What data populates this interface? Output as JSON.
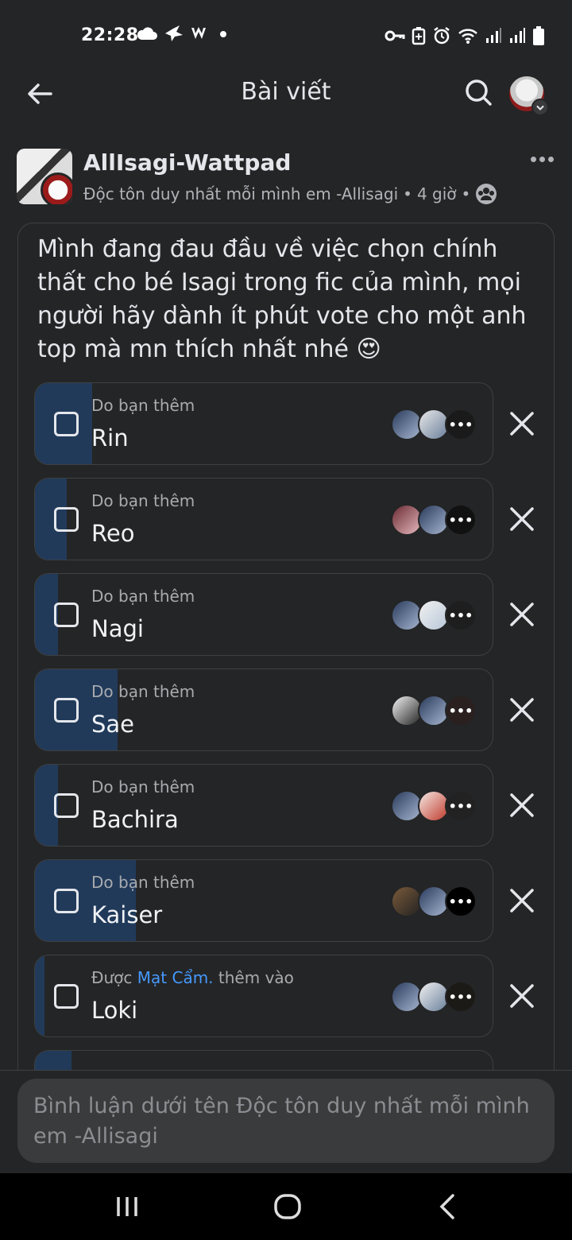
{
  "status_bar": {
    "time": "22:28",
    "left_icons": [
      "cloud-icon",
      "bird-icon",
      "w-icon",
      "dot-icon"
    ],
    "right_icons": [
      "key-icon",
      "battery-saver-icon",
      "alarm-icon",
      "wifi-icon",
      "signal-icon",
      "signal-icon",
      "battery-icon"
    ]
  },
  "header": {
    "title": "Bài viết"
  },
  "post": {
    "group_name": "AllIsagi-Wattpad",
    "author": "Độc tôn duy nhất mỗi mình em -Allisagi",
    "time": "4 giờ",
    "separator": "•",
    "question": "Mình đang đau đầu về việc chọn chính thất cho bé Isagi trong fic của mình, mọi người hãy dành ít phút vote cho một anh top mà mn thích nhất nhé 😍"
  },
  "poll": {
    "options": [
      {
        "sub": "Do bạn thêm",
        "label": "Rin",
        "fill_fraction": 0.125
      },
      {
        "sub": "Do bạn thêm",
        "label": "Reo",
        "fill_fraction": 0.07
      },
      {
        "sub": "Do bạn thêm",
        "label": "Nagi",
        "fill_fraction": 0.05
      },
      {
        "sub": "Do bạn thêm",
        "label": "Sae",
        "fill_fraction": 0.18
      },
      {
        "sub": "Do bạn thêm",
        "label": "Bachira",
        "fill_fraction": 0.05
      },
      {
        "sub": "Do bạn thêm",
        "label": "Kaiser",
        "fill_fraction": 0.22
      },
      {
        "sub_prefix": "Được",
        "sub_link": "Mạt Cẩm.",
        "sub_suffix": "thêm vào",
        "label": "Loki",
        "fill_fraction": 0.02
      }
    ],
    "more_glyph": "•••"
  },
  "comment": {
    "placeholder": "Bình luận dưới tên Độc tôn duy nhất mỗi mình em -Allisagi"
  },
  "colors": {
    "background": "#242526",
    "fill": "#213a5a",
    "link": "#4599ff"
  }
}
